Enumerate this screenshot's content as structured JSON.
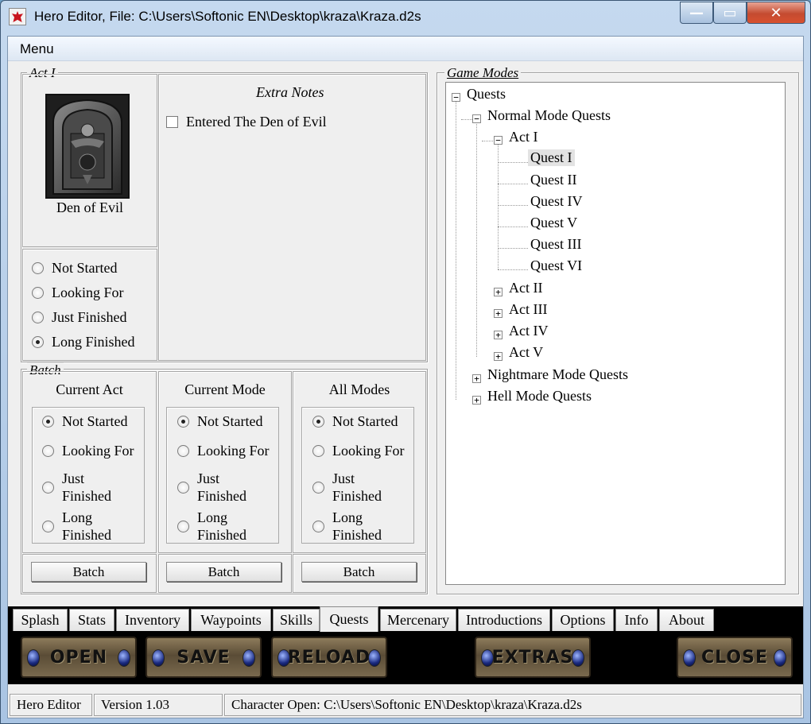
{
  "window": {
    "title": "Hero Editor, File: C:\\Users\\Softonic EN\\Desktop\\kraza\\Kraza.d2s",
    "minimize_glyph": "—",
    "maximize_glyph": "▭",
    "close_glyph": "✕"
  },
  "menubar": {
    "menu": "Menu"
  },
  "act_group": {
    "legend": "Act I",
    "quest_name": "Den of Evil",
    "extra_notes_title": "Extra Notes",
    "extra_note": "Entered The Den of Evil",
    "extra_note_checked": false,
    "states": [
      {
        "label": "Not Started",
        "selected": false
      },
      {
        "label": "Looking For",
        "selected": false
      },
      {
        "label": "Just Finished",
        "selected": false
      },
      {
        "label": "Long Finished",
        "selected": true
      }
    ]
  },
  "batch": {
    "legend": "Batch",
    "columns": [
      {
        "title": "Current Act",
        "options": [
          {
            "label": "Not Started",
            "selected": true
          },
          {
            "label": "Looking For",
            "selected": false
          },
          {
            "label": "Just Finished",
            "selected": false
          },
          {
            "label": "Long Finished",
            "selected": false
          }
        ],
        "button": "Batch"
      },
      {
        "title": "Current Mode",
        "options": [
          {
            "label": "Not Started",
            "selected": true
          },
          {
            "label": "Looking For",
            "selected": false
          },
          {
            "label": "Just Finished",
            "selected": false
          },
          {
            "label": "Long Finished",
            "selected": false
          }
        ],
        "button": "Batch"
      },
      {
        "title": "All Modes",
        "options": [
          {
            "label": "Not Started",
            "selected": true
          },
          {
            "label": "Looking For",
            "selected": false
          },
          {
            "label": "Just Finished",
            "selected": false
          },
          {
            "label": "Long Finished",
            "selected": false
          }
        ],
        "button": "Batch"
      }
    ]
  },
  "game_modes": {
    "legend": "Game Modes",
    "tree": {
      "root": "Quests",
      "normal": "Normal Mode Quests",
      "act1": "Act I",
      "quests": [
        "Quest I",
        "Quest II",
        "Quest IV",
        "Quest V",
        "Quest III",
        "Quest VI"
      ],
      "selected_quest": "Quest I",
      "other_acts": [
        "Act II",
        "Act III",
        "Act IV",
        "Act V"
      ],
      "nightmare": "Nightmare Mode Quests",
      "hell": "Hell Mode Quests"
    }
  },
  "tabs": [
    {
      "label": "Splash",
      "active": false
    },
    {
      "label": "Stats",
      "active": false
    },
    {
      "label": "Inventory",
      "active": false
    },
    {
      "label": "Waypoints",
      "active": false
    },
    {
      "label": "Skills",
      "active": false
    },
    {
      "label": "Quests",
      "active": true
    },
    {
      "label": "Mercenary",
      "active": false
    },
    {
      "label": "Introductions",
      "active": false
    },
    {
      "label": "Options",
      "active": false
    },
    {
      "label": "Info",
      "active": false
    },
    {
      "label": "About",
      "active": false
    }
  ],
  "toolbar": {
    "open": "OPEN",
    "save": "SAVE",
    "reload": "RELOAD",
    "extras": "EXTRAS",
    "close": "CLOSE"
  },
  "statusbar": {
    "app": "Hero Editor",
    "version": "Version 1.03",
    "status": "Character Open: C:\\Users\\Softonic EN\\Desktop\\kraza\\Kraza.d2s"
  }
}
